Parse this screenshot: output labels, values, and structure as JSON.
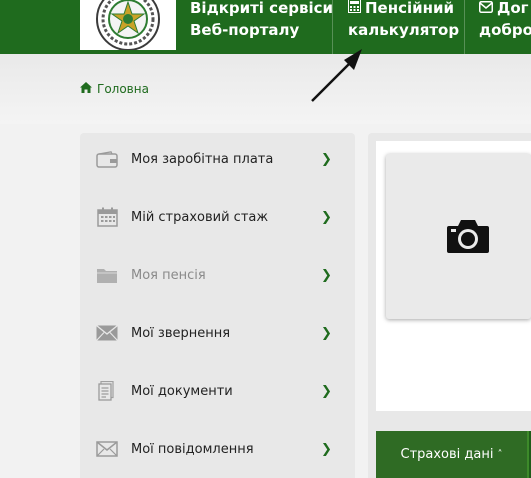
{
  "header": {
    "nav": [
      {
        "line1": "Відкриті сервіси",
        "line2": "Веб-порталу",
        "icon": ""
      },
      {
        "line1": "Пенсійний",
        "line2": "калькулятор",
        "icon": "calculator-icon"
      },
      {
        "line1": "Дог",
        "line2": "добро",
        "icon": "envelope-icon"
      }
    ]
  },
  "breadcrumb": {
    "home_label": "Головна",
    "icon": "home-icon"
  },
  "sidebar": {
    "items": [
      {
        "label": "Моя заробітна плата",
        "icon": "wallet-icon",
        "disabled": false
      },
      {
        "label": "Мій страховий стаж",
        "icon": "calendar-icon",
        "disabled": false
      },
      {
        "label": "Моя пенсія",
        "icon": "folder-icon",
        "disabled": true
      },
      {
        "label": "Мої звернення",
        "icon": "envelope-icon",
        "disabled": false
      },
      {
        "label": "Мої документи",
        "icon": "document-icon",
        "disabled": false
      },
      {
        "label": "Мої повідомлення",
        "icon": "mail-icon",
        "disabled": false
      }
    ]
  },
  "content": {
    "photo_icon": "camera-icon",
    "tab_label": "Страхові дані"
  },
  "colors": {
    "brand_green": "#1f6b1e",
    "tab_green": "#2f6b24",
    "sidebar_bg": "#e8e8e8"
  }
}
